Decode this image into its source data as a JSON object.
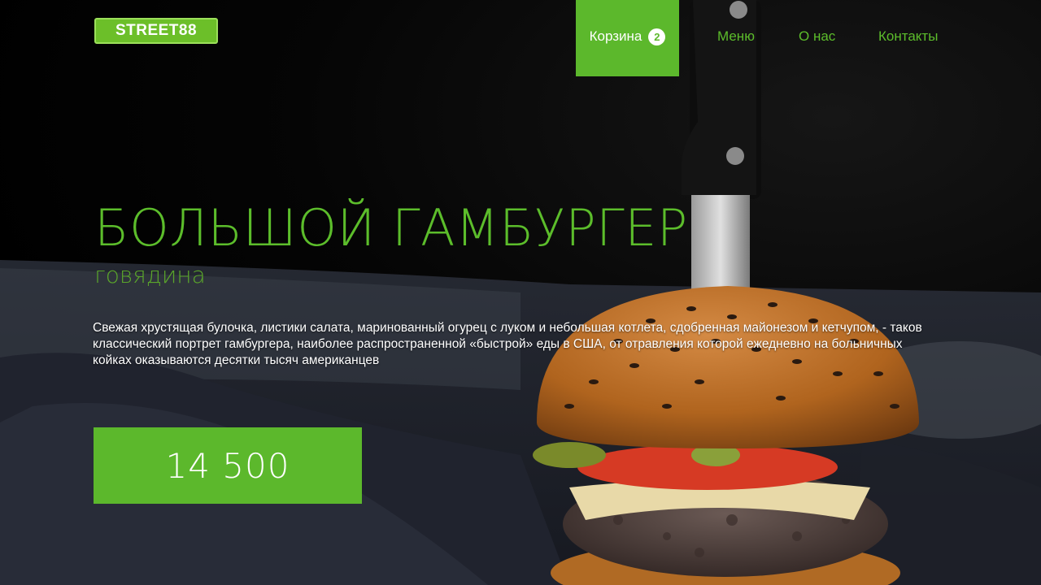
{
  "header": {
    "logo_text": "STREET88",
    "cart": {
      "label": "Корзина",
      "count": "2"
    },
    "nav": [
      "Меню",
      "О нас",
      "Контакты"
    ]
  },
  "product": {
    "title": "БОЛЬШОЙ ГАМБУРГЕР",
    "subtitle": "говядина",
    "description": "Свежая хрустящая булочка, листики салата, маринованный огурец с луком и небольшая котлета, сдобренная майонезом и кетчупом, - таков классический портрет гамбургера, наиболее распространенной «быстрой» еды в США, от отравления которой ежедневно на больничных койках оказываются десятки тысяч американцев",
    "price": "14 500"
  },
  "colors": {
    "accent": "#5cb82c",
    "accent_text": "#5cbd2b",
    "background": "#000000"
  },
  "icons": {
    "hero_image": "burger-with-knife-photo"
  }
}
